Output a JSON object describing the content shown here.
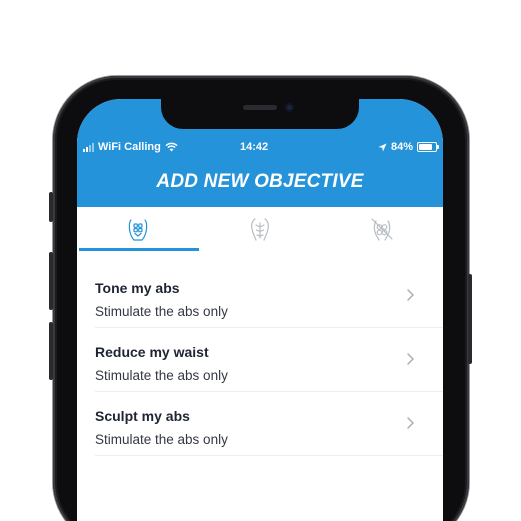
{
  "status_bar": {
    "carrier": "WiFi Calling",
    "time": "14:42",
    "battery": "84%",
    "battery_level": 0.84
  },
  "header": {
    "title": "ADD NEW OBJECTIVE"
  },
  "tabs": [
    {
      "icon": "abs-body-icon",
      "selected": true
    },
    {
      "icon": "torso-body-icon",
      "selected": false
    },
    {
      "icon": "disabled-body-icon",
      "selected": false
    }
  ],
  "objectives": [
    {
      "title": "Tone my abs",
      "subtitle": "Stimulate the abs only"
    },
    {
      "title": "Reduce my waist",
      "subtitle": "Stimulate the abs only"
    },
    {
      "title": "Sculpt my abs",
      "subtitle": "Stimulate the abs only"
    }
  ],
  "colors": {
    "accent": "#2493d9",
    "text_primary": "#1f2433",
    "icon_inactive": "#b8bcc4"
  }
}
